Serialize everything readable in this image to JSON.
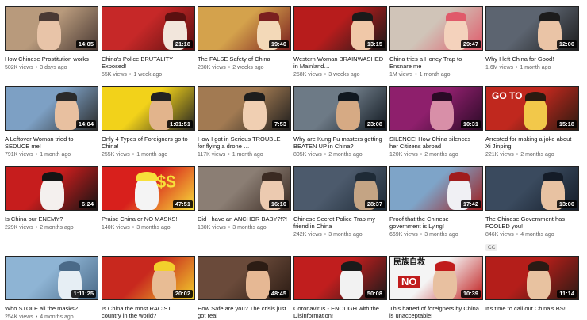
{
  "videos": [
    {
      "title": "How Chinese Prostitution works",
      "views": "502K views",
      "age": "3 days ago",
      "duration": "14:05",
      "colors": [
        "#b89a7c",
        "#e8c4a8",
        "#4a3a34"
      ]
    },
    {
      "title": "China's Police BRUTALITY Exposed!",
      "views": "55K views",
      "age": "1 week ago",
      "duration": "21:18",
      "colors": [
        "#c62828",
        "#f2e6dc",
        "#5a1010"
      ]
    },
    {
      "title": "The FALSE Safety of China",
      "views": "280K views",
      "age": "2 weeks ago",
      "duration": "19:40",
      "colors": [
        "#d4a24c",
        "#f3d9b8",
        "#7a1f1f"
      ]
    },
    {
      "title": "Western Woman BRAINWASHED in Mainland…",
      "views": "258K views",
      "age": "3 weeks ago",
      "duration": "13:15",
      "colors": [
        "#b71c1c",
        "#f0c8a8",
        "#1a1a1a"
      ]
    },
    {
      "title": "China tries a Honey Trap to Ensnare me",
      "views": "1M views",
      "age": "1 month ago",
      "duration": "29:47",
      "colors": [
        "#d0c4b8",
        "#f4d2bc",
        "#e05a6a"
      ]
    },
    {
      "title": "Why I left China for Good!",
      "views": "1.6M views",
      "age": "1 month ago",
      "duration": "12:00",
      "colors": [
        "#5c6470",
        "#eac4a6",
        "#1c1c1c"
      ]
    },
    {
      "title": "A Leftover Woman tried to SEDUCE me!",
      "views": "791K views",
      "age": "1 month ago",
      "duration": "14:04",
      "colors": [
        "#7da0c4",
        "#e8c0a0",
        "#2a2a2a"
      ]
    },
    {
      "title": "Only 4 Types of Foreigners go to China!",
      "views": "255K views",
      "age": "1 month ago",
      "duration": "1:01:51",
      "colors": [
        "#f2d21a",
        "#e2b48c",
        "#222222"
      ]
    },
    {
      "title": "How I got in Serious TROUBLE for flying a drone …",
      "views": "117K views",
      "age": "1 month ago",
      "duration": "7:53",
      "colors": [
        "#a27a52",
        "#f0cfb2",
        "#1d1d1d"
      ]
    },
    {
      "title": "Why are Kung Fu masters getting BEATEN UP in China?",
      "views": "805K views",
      "age": "2 months ago",
      "duration": "23:08",
      "colors": [
        "#6d7a86",
        "#d6aa84",
        "#101820"
      ]
    },
    {
      "title": "SILENCE! How China silences her Citizens abroad",
      "views": "120K views",
      "age": "2 months ago",
      "duration": "10:31",
      "colors": [
        "#8e1f6c",
        "#d88fa8",
        "#2a0a26"
      ]
    },
    {
      "title": "Arrested for making a joke about Xi Jinping",
      "views": "221K views",
      "age": "2 months ago",
      "duration": "15:18",
      "colors": [
        "#c0281e",
        "#f2c84a",
        "#2a1a10"
      ]
    },
    {
      "title": "Is China our ENEMY?",
      "views": "229K views",
      "age": "2 months ago",
      "duration": "6:24",
      "colors": [
        "#c61d1d",
        "#f4f0ee",
        "#141414"
      ]
    },
    {
      "title": "Praise China or NO MASKS!",
      "views": "140K views",
      "age": "3 months ago",
      "duration": "47:51",
      "colors": [
        "#d8201c",
        "#f4f4f4",
        "#f7e03a"
      ]
    },
    {
      "title": "Did I have an ANCHOR BABY?!?!",
      "views": "180K views",
      "age": "3 months ago",
      "duration": "16:10",
      "colors": [
        "#8b7e74",
        "#eccab0",
        "#3a2a22"
      ]
    },
    {
      "title": "Chinese Secret Police Trap my friend in China",
      "views": "242K views",
      "age": "3 months ago",
      "duration": "28:37",
      "colors": [
        "#4c5a6c",
        "#c4a484",
        "#1e2a36"
      ]
    },
    {
      "title": "Proof that the Chinese government is Lying!",
      "views": "669K views",
      "age": "3 months ago",
      "duration": "17:42",
      "colors": [
        "#7ea4c8",
        "#f0f0f4",
        "#a01c1c"
      ]
    },
    {
      "title": "The Chinese Government has FOOLED you!",
      "views": "846K views",
      "age": "4 months ago",
      "duration": "13:00",
      "colors": [
        "#3a4a5e",
        "#e8c2a2",
        "#141c28"
      ],
      "cc": "CC"
    },
    {
      "title": "Who STOLE all the masks?",
      "views": "254K views",
      "age": "4 months ago",
      "duration": "1:11:25",
      "colors": [
        "#8eb4d4",
        "#e6eef4",
        "#4a6a88"
      ]
    },
    {
      "title": "Is China the most RACIST country in the world?",
      "views": "",
      "age": "",
      "duration": "20:02",
      "colors": [
        "#c8281e",
        "#e8bc94",
        "#f2d02c"
      ]
    },
    {
      "title": "How Safe are you? The crisis just got real",
      "views": "",
      "age": "",
      "duration": "48:45",
      "colors": [
        "#6a4a3a",
        "#e6b894",
        "#2c1c14"
      ]
    },
    {
      "title": "Coronavirus - ENOUGH with the Disinformation!",
      "views": "",
      "age": "",
      "duration": "50:08",
      "colors": [
        "#c01e1e",
        "#f2f2f2",
        "#1a1a1a"
      ]
    },
    {
      "title": "This hatred of foreigners by China is unacceptable!",
      "views": "",
      "age": "",
      "duration": "10:39",
      "colors": [
        "#f4f4f4",
        "#e8c0a0",
        "#c01c1c"
      ]
    },
    {
      "title": "It's time to call out China's BS!",
      "views": "",
      "age": "",
      "duration": "11:14",
      "colors": [
        "#b41e1a",
        "#e8c2a0",
        "#2a1a14"
      ]
    }
  ],
  "overlays": {
    "v8": "$$",
    "v12": "GO TO",
    "v23": "NO",
    "v23b": "民族自救"
  }
}
